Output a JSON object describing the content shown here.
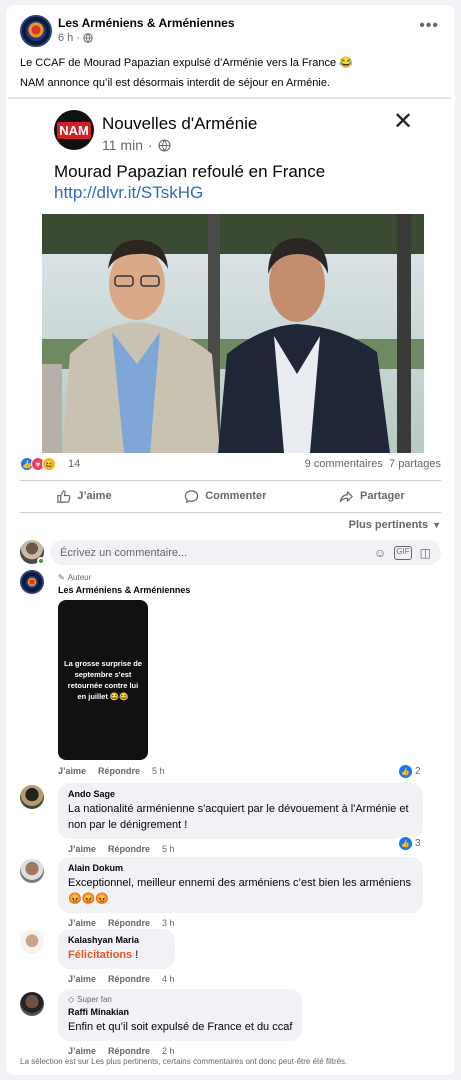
{
  "post": {
    "page_name": "Les Arméniens & Arméniennes",
    "time": "6 h",
    "more": "•••",
    "text_lines": [
      "Le CCAF de Mourad Papazian expulsé d’Arménie vers la France 😂",
      "NAM annonce qu’il est désormais interdit de séjour en Arménie."
    ]
  },
  "shared": {
    "logo_text": "NAM",
    "name": "Nouvelles d'Arménie",
    "time": "11 min",
    "text": "Mourad Papazian refoulé en France ",
    "link": "http://dlvr.it/STskHG"
  },
  "stats": {
    "reaction_count": "14",
    "comments": "9 commentaires",
    "shares": "7 partages"
  },
  "actions": {
    "like": "J’aime",
    "comment": "Commenter",
    "share": "Partager"
  },
  "sort_label": "Plus pertinents",
  "comment_placeholder": "Écrivez un commentaire...",
  "comments": [
    {
      "badge": "Auteur",
      "name": "Les Arméniens & Arméniennes",
      "image_text": "La grosse surprise de septembre s'est retournée contre lui en juillet 😂😂",
      "like": "J’aime",
      "reply": "Répondre",
      "time": "5 h",
      "likes": "2"
    },
    {
      "name": "Ando Sage",
      "text": "La nationalité arménienne s'acquiert par le dévouement à l'Arménie et non par le dénigrement !",
      "like": "J’aime",
      "reply": "Répondre",
      "time": "5 h",
      "likes": "3"
    },
    {
      "name": "Alain Dokum",
      "text": "Exceptionnel, meilleur ennemi des arméniens c’est bien les arméniens 😡😡😡",
      "like": "J’aime",
      "reply": "Répondre",
      "time": "3 h"
    },
    {
      "name": "Kalashyan Maria",
      "text_highlight": "Félicitations",
      "text_rest": " !",
      "like": "J’aime",
      "reply": "Répondre",
      "time": "4 h"
    },
    {
      "badge": "Super fan",
      "name": "Raffi Minakian",
      "text": "Enfin et qu’il soit expulsé de France et du ccaf",
      "like": "J’aime",
      "reply": "Répondre",
      "time": "2 h"
    }
  ],
  "footer_note": "La sélection est sur Les plus pertinents, certains commentaires ont donc peut-être été filtrés.",
  "colors": {
    "link": "#2a6ebf",
    "like_blue": "#1877f2",
    "muted": "#65676b",
    "highlight": "#e4572e"
  }
}
